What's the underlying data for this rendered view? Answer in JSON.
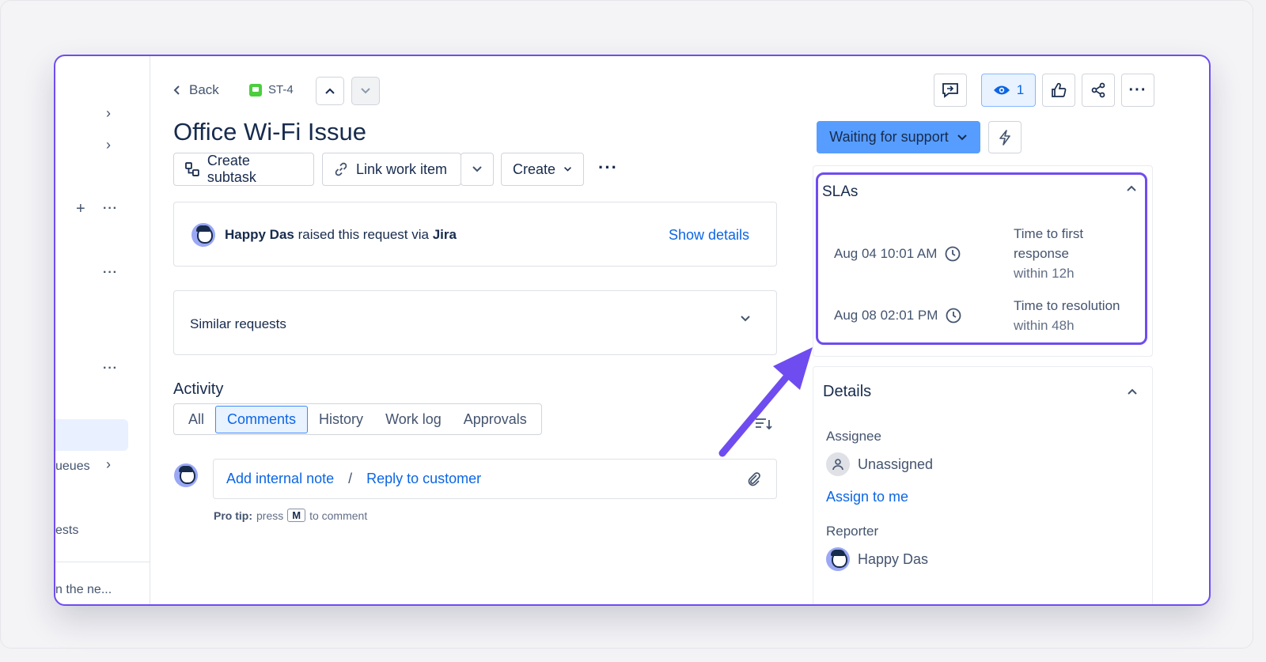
{
  "sidebar": {
    "queues_label": "ueues",
    "requests_label": "ests",
    "truncated_item": "n the ne..."
  },
  "header": {
    "back_label": "Back",
    "issue_key": "ST-4",
    "title": "Office Wi-Fi Issue"
  },
  "toolbar": {
    "create_subtask": "Create subtask",
    "link_work_item": "Link work item",
    "create": "Create"
  },
  "request": {
    "reporter_name": "Happy Das",
    "raised_text": "raised this request via",
    "channel": "Jira",
    "show_details": "Show details"
  },
  "similar": {
    "label": "Similar requests"
  },
  "activity": {
    "title": "Activity",
    "tabs": [
      "All",
      "Comments",
      "History",
      "Work log",
      "Approvals"
    ],
    "active_tab": "Comments",
    "add_internal_note": "Add internal note",
    "separator": "/",
    "reply_to_customer": "Reply to customer",
    "pro_tip_label": "Pro tip:",
    "pro_tip_press": "press",
    "pro_tip_key": "M",
    "pro_tip_suffix": "to comment"
  },
  "actions": {
    "watch_count": "1"
  },
  "status": {
    "label": "Waiting for support"
  },
  "slas": {
    "title": "SLAs",
    "items": [
      {
        "date": "Aug 04 10:01 AM",
        "name_line1": "Time to first",
        "name_line2": "response",
        "target": "within 12h"
      },
      {
        "date": "Aug 08 02:01 PM",
        "name_line1": "Time to resolution",
        "name_line2": "",
        "target": "within 48h"
      }
    ]
  },
  "details": {
    "title": "Details",
    "assignee_label": "Assignee",
    "assignee_value": "Unassigned",
    "assign_to_me": "Assign to me",
    "reporter_label": "Reporter",
    "reporter_value": "Happy Das"
  },
  "colors": {
    "accent": "#6f4cf0",
    "link": "#0c66e4",
    "status_bg": "#579dff"
  }
}
